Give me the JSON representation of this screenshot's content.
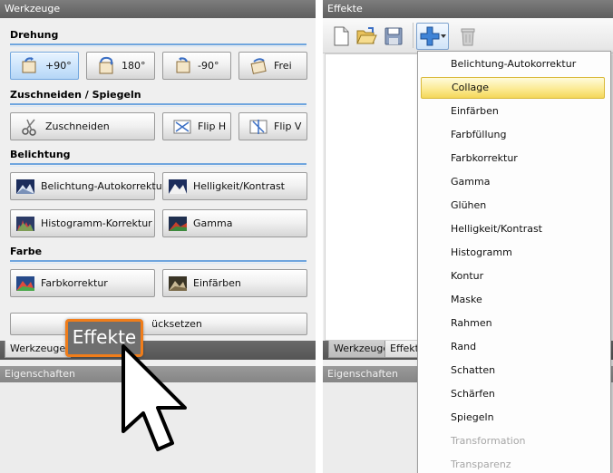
{
  "left_panel": {
    "title": "Werkzeuge",
    "sections": {
      "rotation": "Drehung",
      "crop": "Zuschneiden / Spiegeln",
      "exposure": "Belichtung",
      "color": "Farbe"
    },
    "buttons": {
      "rotate_cw": "+90°",
      "rotate_180": "180°",
      "rotate_ccw": "-90°",
      "rotate_free": "Frei",
      "crop": "Zuschneiden",
      "flip_h": "Flip H",
      "flip_v": "Flip V",
      "auto_exposure": "Belichtung-Autokorrektur",
      "brightness_contrast": "Helligkeit/Kontrast",
      "histogram": "Histogramm-Korrektur",
      "gamma": "Gamma",
      "color_correction": "Farbkorrektur",
      "colorize": "Einfärben",
      "reset": "ücksetzen"
    },
    "tabs": [
      "Werkzeuge"
    ],
    "properties_title": "Eigenschaften"
  },
  "callout": {
    "label": "Effekte"
  },
  "right_panel": {
    "title": "Effekte",
    "toolbar_icons": [
      "new-icon",
      "open-icon",
      "save-icon",
      "add-icon",
      "delete-icon"
    ],
    "tabs": [
      "Werkzeuge",
      "Effekte"
    ],
    "properties_title": "Eigenschaften",
    "menu": {
      "items": [
        "Belichtung-Autokorrektur",
        "Collage",
        "Einfärben",
        "Farbfüllung",
        "Farbkorrektur",
        "Gamma",
        "Glühen",
        "Helligkeit/Kontrast",
        "Histogramm",
        "Kontur",
        "Maske",
        "Rahmen",
        "Rand",
        "Schatten",
        "Schärfen",
        "Spiegeln",
        "Transformation",
        "Transparenz"
      ],
      "highlighted": "Collage",
      "disabled": [
        "Transformation",
        "Transparenz"
      ]
    }
  },
  "colors": {
    "accent_blue": "#6fa5de",
    "callout_border": "#f07d1a",
    "highlight": "#fbe98e"
  }
}
